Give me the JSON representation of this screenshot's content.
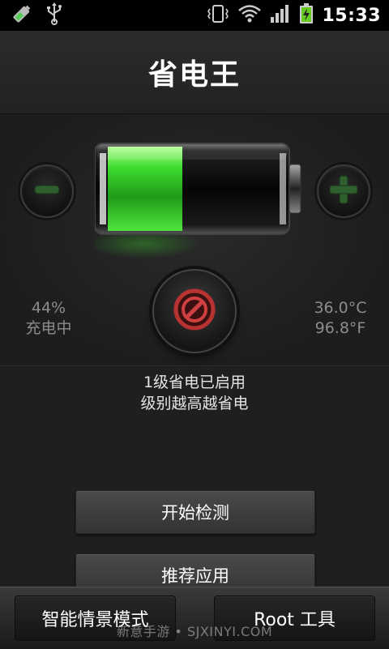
{
  "status_bar": {
    "time": "15:33",
    "left_icons": [
      "battery-charging-icon",
      "usb-icon"
    ],
    "right_icons": [
      "vibrate-icon",
      "wifi-icon",
      "signal-icon",
      "battery-icon"
    ]
  },
  "header": {
    "title": "省电王"
  },
  "battery": {
    "level_percent": 44,
    "fill_color": "#3ddc2e"
  },
  "stats": {
    "percent": "44%",
    "state": "充电中",
    "temp_c": "36.0°C",
    "temp_f": "96.8°F"
  },
  "info": {
    "line1": "1级省电已启用",
    "line2": "级别越高越省电"
  },
  "buttons": {
    "start_detect": "开始检测",
    "recommend": "推荐应用"
  },
  "bottom": {
    "smart_mode": "智能情景模式",
    "root_tools": "Root 工具"
  },
  "watermark": "新意手游 • SJXINYI.COM"
}
